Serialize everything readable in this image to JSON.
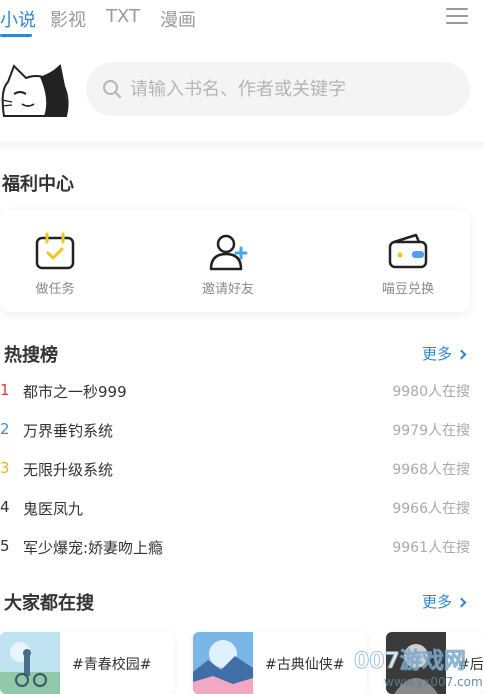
{
  "tabs": [
    {
      "label": "小说",
      "active": true
    },
    {
      "label": "影视",
      "active": false
    },
    {
      "label": "TXT",
      "active": false
    },
    {
      "label": "漫画",
      "active": false
    }
  ],
  "search": {
    "placeholder": "请输入书名、作者或关键字"
  },
  "benefits": {
    "title": "福利中心",
    "items": [
      {
        "label": "做任务",
        "icon": "calendar-check-icon"
      },
      {
        "label": "邀请好友",
        "icon": "add-user-icon"
      },
      {
        "label": "喵豆兑换",
        "icon": "wallet-icon"
      }
    ]
  },
  "hot": {
    "title": "热搜榜",
    "more": "更多",
    "items": [
      {
        "rank": "1",
        "title": "都市之一秒999",
        "count": "9980人在搜",
        "color": "#e23b3b"
      },
      {
        "rank": "2",
        "title": "万界垂钓系统",
        "count": "9979人在搜",
        "color": "#3b8fd9"
      },
      {
        "rank": "3",
        "title": "无限升级系统",
        "count": "9968人在搜",
        "color": "#f0b429"
      },
      {
        "rank": "4",
        "title": "鬼医凤九",
        "count": "9966人在搜",
        "color": "#333333"
      },
      {
        "rank": "5",
        "title": "军少爆宠:娇妻吻上瘾",
        "count": "9961人在搜",
        "color": "#333333"
      }
    ]
  },
  "everyone": {
    "title": "大家都在搜",
    "more": "更多",
    "tags": [
      {
        "label": "#青春校园#"
      },
      {
        "label": "#古典仙侠#"
      },
      {
        "label": "#后"
      }
    ]
  },
  "watermark": {
    "brand": "007游戏网",
    "url": "www.yx007.com"
  },
  "colors": {
    "accent": "#2f86d6",
    "icon_yellow": "#f5c518",
    "icon_blue": "#4aa3ec"
  }
}
